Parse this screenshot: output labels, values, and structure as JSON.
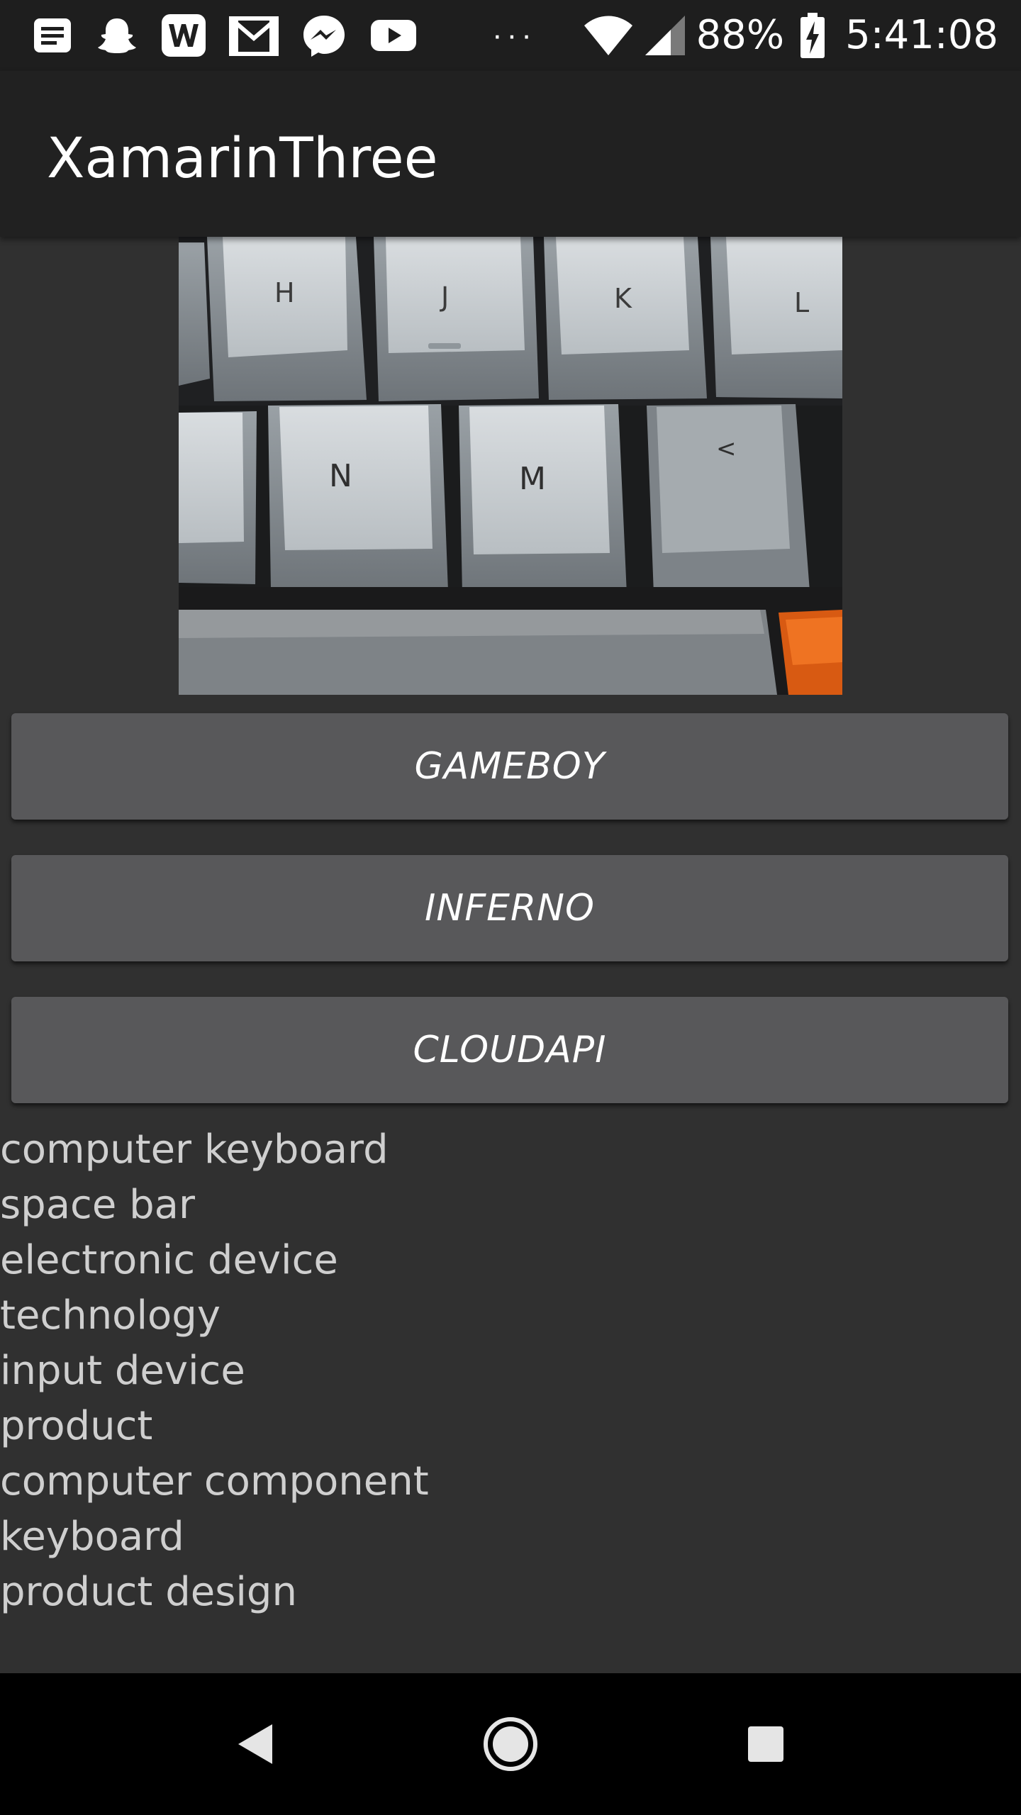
{
  "status_bar": {
    "left_icons": [
      "notes-icon",
      "snapchat-icon",
      "word-icon",
      "gmail-icon",
      "messenger-icon",
      "youtube-icon"
    ],
    "overflow_label": "···",
    "battery_percent": "88%",
    "time": "5:41:08"
  },
  "app_bar": {
    "title": "XamarinThree"
  },
  "photo": {
    "subject": "keyboard-photo",
    "keys_row1": [
      "H",
      "J",
      "K",
      "L"
    ],
    "keys_row2": [
      "N",
      "M",
      "<"
    ]
  },
  "buttons": [
    {
      "label": "GAMEBOY"
    },
    {
      "label": "INFERNO"
    },
    {
      "label": "CLOUDAPI"
    }
  ],
  "labels": [
    "computer keyboard",
    "space bar",
    "electronic device",
    "technology",
    "input device",
    "product",
    "computer component",
    "keyboard",
    "product design"
  ],
  "nav_bar": {
    "icons": [
      "back-icon",
      "home-icon",
      "recents-icon"
    ]
  },
  "colors": {
    "background": "#303030",
    "app_bar": "#212121",
    "status_bar": "#1e1e1e",
    "button": "#58585a",
    "label_text": "#cfcfcf",
    "nav_bar": "#000000"
  }
}
